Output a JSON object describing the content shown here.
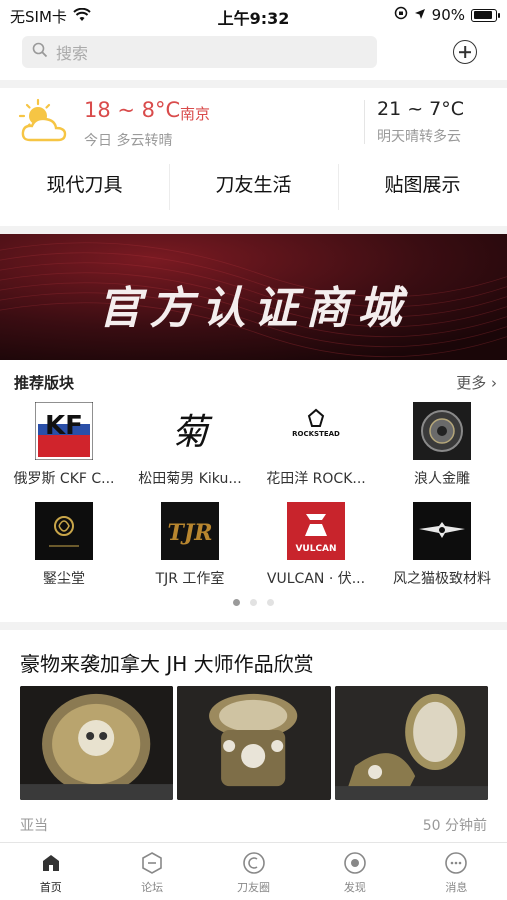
{
  "status": {
    "carrier": "无SIM卡",
    "time": "上午9:32",
    "battery": "90%",
    "battery_level": 0.9
  },
  "search": {
    "placeholder": "搜索"
  },
  "weather": {
    "today_temp": "18 ~ 8°C",
    "city": "南京",
    "today_desc": "今日 多云转晴",
    "tomorrow_temp": "21 ~ 7°C",
    "tomorrow_desc": "明天晴转多云"
  },
  "categories": [
    "现代刀具",
    "刀友生活",
    "贴图展示"
  ],
  "banner": {
    "text": "官方认证商城"
  },
  "recommend": {
    "title": "推荐版块",
    "more": "更多",
    "items": [
      {
        "name": "俄罗斯 CKF C...",
        "logo": "ckf-logo",
        "logo_text": "KF"
      },
      {
        "name": "松田菊男 Kiku...",
        "logo": "kiku-logo",
        "logo_text": "菊"
      },
      {
        "name": "花田洋 ROCK...",
        "logo": "rockstead-logo",
        "logo_text": "ROCKSTEAD"
      },
      {
        "name": "浪人金雕",
        "logo": "ronin-logo",
        "logo_text": ""
      },
      {
        "name": "鋻尘堂",
        "logo": "jianchentang-logo",
        "logo_text": ""
      },
      {
        "name": "TJR 工作室",
        "logo": "tjr-logo",
        "logo_text": "TJR"
      },
      {
        "name": "VULCAN · 伏...",
        "logo": "vulcan-logo",
        "logo_text": "VULCAN"
      },
      {
        "name": "风之猫极致材料",
        "logo": "wind-cat-logo",
        "logo_text": ""
      }
    ],
    "pages": 3,
    "active_page": 0
  },
  "article": {
    "title": "豪物来袭加拿大 JH 大师作品欣赏",
    "author": "亚当",
    "time": "50 分钟前"
  },
  "tabs": [
    {
      "label": "首页",
      "icon": "home-icon",
      "active": true
    },
    {
      "label": "论坛",
      "icon": "forum-icon",
      "active": false
    },
    {
      "label": "刀友圈",
      "icon": "circle-icon",
      "active": false
    },
    {
      "label": "发现",
      "icon": "discover-icon",
      "active": false
    },
    {
      "label": "消息",
      "icon": "message-icon",
      "active": false
    }
  ],
  "colors": {
    "accent_red": "#d94b4b",
    "banner_bg": "#2a0c10"
  }
}
